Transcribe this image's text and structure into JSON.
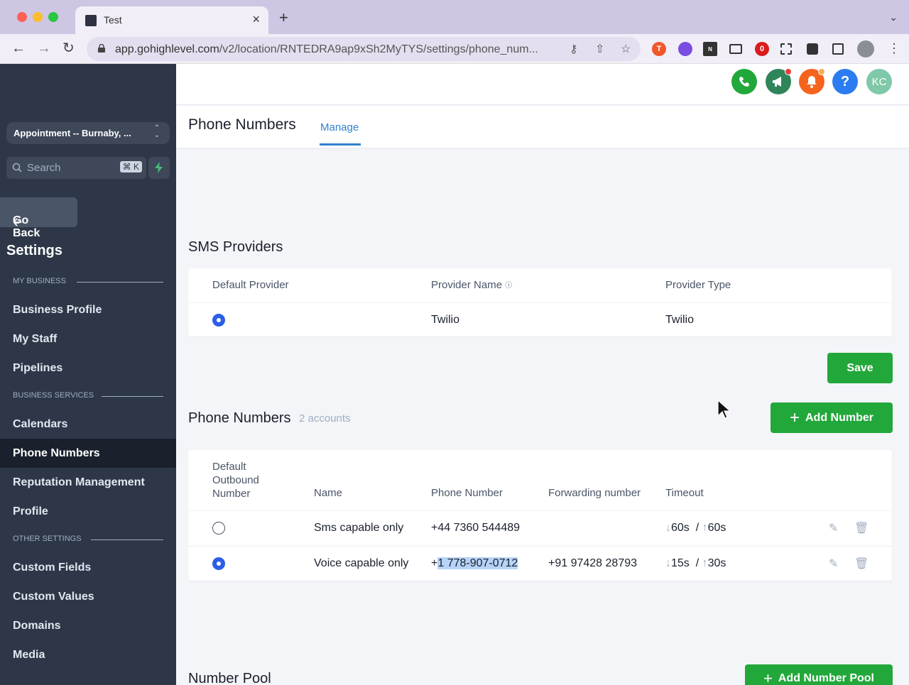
{
  "browser": {
    "tab_title": "Test",
    "url_host": "app.gohighlevel.com",
    "url_path": "/v2/location/RNTEDRA9ap9xSh2MyTYS/settings/phone_num..."
  },
  "sidebar": {
    "location": "Appointment -- Burnaby, ...",
    "search_placeholder": "Search",
    "search_shortcut": "⌘ K",
    "go_back": "Go Back",
    "settings_title": "Settings",
    "sections": {
      "my_business": "MY BUSINESS",
      "business_services": "BUSINESS SERVICES",
      "other_settings": "OTHER SETTINGS"
    },
    "items": [
      {
        "label": "Business Profile"
      },
      {
        "label": "My Staff"
      },
      {
        "label": "Pipelines"
      },
      {
        "label": "Calendars"
      },
      {
        "label": "Phone Numbers"
      },
      {
        "label": "Reputation Management"
      },
      {
        "label": "Profile"
      },
      {
        "label": "Custom Fields"
      },
      {
        "label": "Custom Values"
      },
      {
        "label": "Domains"
      },
      {
        "label": "Media"
      }
    ],
    "active_item": "Phone Numbers"
  },
  "topbar": {
    "avatar_initials": "KC",
    "help_label": "?"
  },
  "header": {
    "title": "Phone Numbers",
    "tab_manage": "Manage"
  },
  "sms_providers": {
    "title": "SMS Providers",
    "columns": [
      "Default Provider",
      "Provider Name",
      "Provider Type"
    ],
    "rows": [
      {
        "default": true,
        "name": "Twilio",
        "type": "Twilio"
      }
    ],
    "save_label": "Save"
  },
  "phone_numbers": {
    "title": "Phone Numbers",
    "count_label": "2 accounts",
    "add_label": "Add Number",
    "columns": {
      "default_line1": "Default",
      "default_line2": "Outbound",
      "default_line3": "Number",
      "name": "Name",
      "phone": "Phone Number",
      "forwarding": "Forwarding number",
      "timeout": "Timeout"
    },
    "rows": [
      {
        "default": false,
        "name": "Sms capable only",
        "phone_prefix": "+44 7360 544489",
        "phone_highlight": "",
        "forwarding": "",
        "timeout_in": "60s",
        "timeout_out": "60s"
      },
      {
        "default": true,
        "name": "Voice capable only",
        "phone_prefix": "+",
        "phone_highlight": "1 778-907-0712",
        "forwarding": "+91 97428 28793",
        "timeout_in": "15s",
        "timeout_out": "30s"
      }
    ]
  },
  "number_pool": {
    "title": "Number Pool",
    "add_label": "Add Number Pool"
  },
  "colors": {
    "sidebar_bg": "#2d3748",
    "accent_blue": "#3182ce",
    "button_green": "#22a83a",
    "radio_blue": "#2b5ee8"
  }
}
